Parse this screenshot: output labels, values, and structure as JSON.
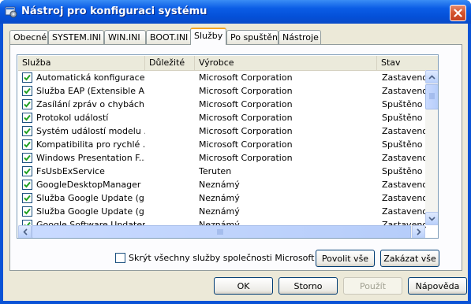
{
  "window": {
    "title": "Nástroj pro konfiguraci systému"
  },
  "tabs": [
    {
      "label": "Obecné",
      "active": false
    },
    {
      "label": "SYSTEM.INI",
      "active": false
    },
    {
      "label": "WIN.INI",
      "active": false
    },
    {
      "label": "BOOT.INI",
      "active": false
    },
    {
      "label": "Služby",
      "active": true
    },
    {
      "label": "Po spuštění",
      "active": false
    },
    {
      "label": "Nástroje",
      "active": false
    }
  ],
  "table": {
    "columns": [
      "Služba",
      "Důležité",
      "Výrobce",
      "Stav"
    ],
    "rows": [
      {
        "checked": true,
        "service": "Automatická konfigurace...",
        "essential": "",
        "vendor": "Microsoft Corporation",
        "status": "Zastaveno"
      },
      {
        "checked": true,
        "service": "Služba EAP (Extensible A...",
        "essential": "",
        "vendor": "Microsoft Corporation",
        "status": "Zastaveno"
      },
      {
        "checked": true,
        "service": "Zasílání zpráv o chybách",
        "essential": "",
        "vendor": "Microsoft Corporation",
        "status": "Spuštěno"
      },
      {
        "checked": true,
        "service": "Protokol událostí",
        "essential": "",
        "vendor": "Microsoft Corporation",
        "status": "Spuštěno"
      },
      {
        "checked": true,
        "service": "Systém událostí modelu ...",
        "essential": "",
        "vendor": "Microsoft Corporation",
        "status": "Zastaveno"
      },
      {
        "checked": true,
        "service": "Kompatibilita pro rychlé ...",
        "essential": "",
        "vendor": "Microsoft Corporation",
        "status": "Spuštěno"
      },
      {
        "checked": true,
        "service": "Windows Presentation F...",
        "essential": "",
        "vendor": "Microsoft Corporation",
        "status": "Zastaveno"
      },
      {
        "checked": true,
        "service": "FsUsbExService",
        "essential": "",
        "vendor": "Teruten",
        "status": "Spuštěno"
      },
      {
        "checked": true,
        "service": "GoogleDesktopManager",
        "essential": "",
        "vendor": "Neznámý",
        "status": "Zastaveno"
      },
      {
        "checked": true,
        "service": "Služba Google Update (g...",
        "essential": "",
        "vendor": "Neznámý",
        "status": "Zastaveno"
      },
      {
        "checked": true,
        "service": "Služba Google Update (g...",
        "essential": "",
        "vendor": "Neznámý",
        "status": "Zastaveno"
      },
      {
        "checked": true,
        "service": "Google Software Updater",
        "essential": "",
        "vendor": "Neznámý",
        "status": "Zastaveno"
      }
    ]
  },
  "hide_ms": {
    "label": "Skrýt všechny služby společnosti Microsoft",
    "checked": false
  },
  "buttons": {
    "enable_all": "Povolit vše",
    "disable_all": "Zakázat vše",
    "ok": "OK",
    "cancel": "Storno",
    "apply": "Použít",
    "help": "Nápověda"
  },
  "colors": {
    "titlebar": "#0a53d6",
    "close": "#d4532c",
    "active_tab": "#f5a623",
    "dialog_bg": "#ece9d8"
  }
}
